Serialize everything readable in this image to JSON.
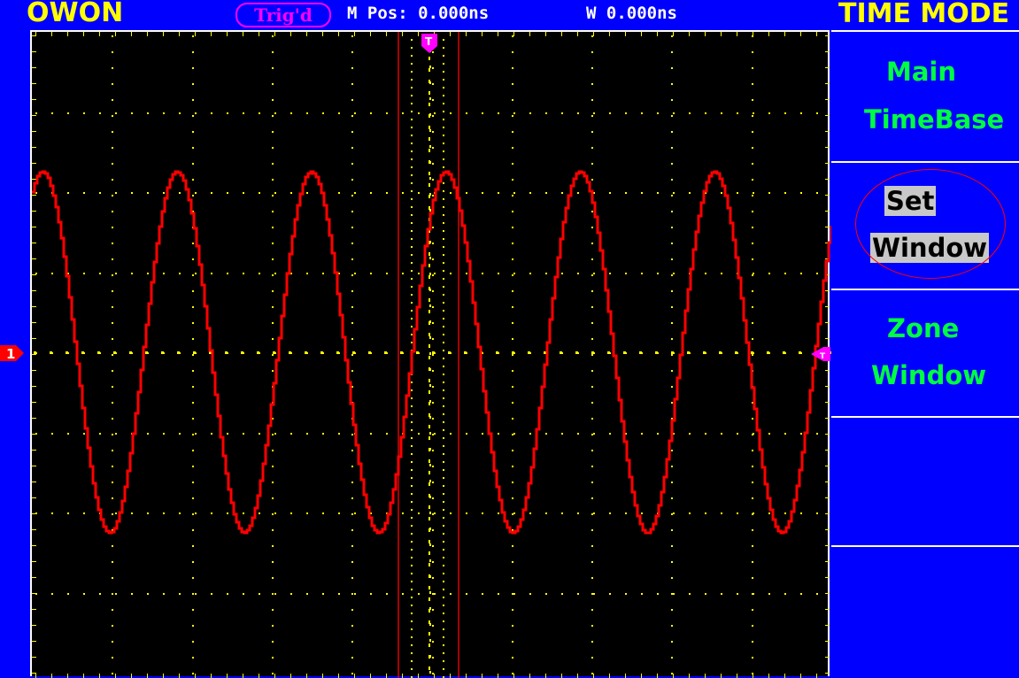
{
  "topbar": {
    "brand": "OWON",
    "trigger_status": "Trig'd",
    "m_pos": "M Pos: 0.000ns",
    "w_val": "W 0.000ns",
    "mode_title": "TIME MODE"
  },
  "markers": {
    "trigger_top": "T",
    "channel_left": "1",
    "trigger_level_right": "T"
  },
  "menu": {
    "items": [
      {
        "line1": "Main",
        "line2": "TimeBase",
        "selected": false
      },
      {
        "line1": "Set",
        "line2": "Window",
        "selected": true
      },
      {
        "line1": "Zone",
        "line2": "Window",
        "selected": false
      },
      {
        "line1": "",
        "line2": "",
        "selected": false
      },
      {
        "line1": "",
        "line2": "",
        "selected": false
      }
    ]
  },
  "colors": {
    "background": "#0000ff",
    "screen": "#000000",
    "waveform": "#ff0000",
    "grid": "#ffff00",
    "menu_text": "#00ff40",
    "title_text": "#ffff00",
    "trigger_marker": "#ff00ff"
  },
  "waveform": {
    "type": "sine",
    "cycles_visible": 5.95
  }
}
